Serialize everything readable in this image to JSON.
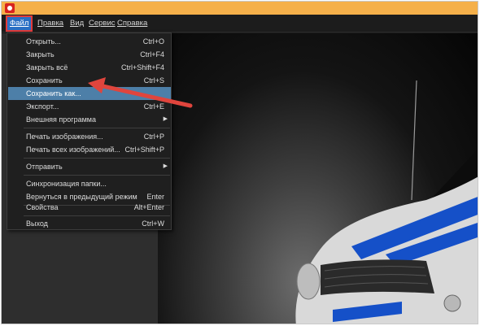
{
  "menubar": {
    "items": [
      {
        "label": "Файл",
        "active": true
      },
      {
        "label": "Правка",
        "active": false
      },
      {
        "label": "Вид",
        "active": false
      },
      {
        "label": "Сервис",
        "active": false
      },
      {
        "label": "Справка",
        "active": false
      }
    ]
  },
  "file_menu": {
    "items": [
      {
        "label": "Открыть...",
        "shortcut": "Ctrl+O"
      },
      {
        "label": "Закрыть",
        "shortcut": "Ctrl+F4"
      },
      {
        "label": "Закрыть всё",
        "shortcut": "Ctrl+Shift+F4"
      },
      {
        "label": "Сохранить",
        "shortcut": "Ctrl+S"
      },
      {
        "label": "Сохранить как...",
        "shortcut": "",
        "highlighted": true
      },
      {
        "label": "Экспорт...",
        "shortcut": "Ctrl+E"
      },
      {
        "label": "Внешняя программа",
        "shortcut": "",
        "submenu": true
      },
      {
        "label": "Печать изображения...",
        "shortcut": "Ctrl+P"
      },
      {
        "label": "Печать всех изображений...",
        "shortcut": "Ctrl+Shift+P"
      },
      {
        "label": "Отправить",
        "shortcut": "",
        "submenu": true
      },
      {
        "label": "Синхронизация папки...",
        "shortcut": ""
      },
      {
        "label": "Вернуться в предыдущий режим",
        "shortcut": "Enter"
      },
      {
        "label": "Свойства",
        "shortcut": "Alt+Enter"
      },
      {
        "label": "Выход",
        "shortcut": "Ctrl+W"
      }
    ]
  },
  "colors": {
    "titlebar": "#f5b04a",
    "menu_highlight": "#4d7fa8",
    "annotation_arrow": "#e0453d",
    "car_stripe": "#1550c8"
  },
  "icons": {
    "app": "app-camera-icon",
    "submenu": "chevron-right-icon"
  }
}
